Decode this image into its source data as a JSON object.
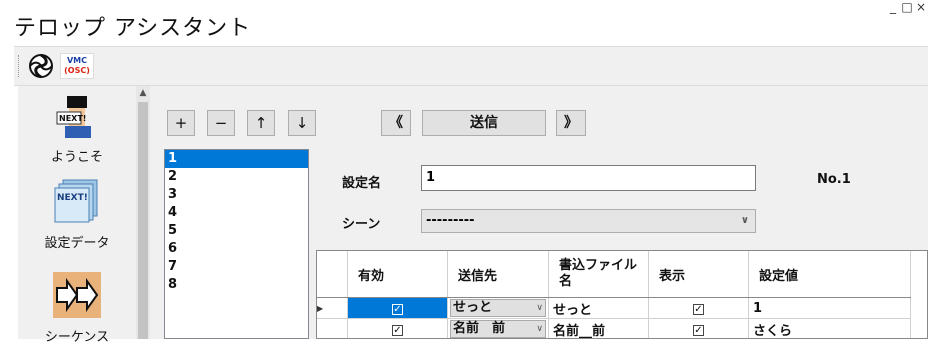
{
  "window": {
    "title": "テロップ アシスタント",
    "controls": [
      "_",
      "□",
      "×"
    ]
  },
  "toolbar": {
    "vmc_text": "VMC",
    "osc_text": "(OSC)"
  },
  "sidebar": {
    "items": [
      {
        "label": "ようこそ",
        "icon": "welcome-person-icon"
      },
      {
        "label": "設定データ",
        "icon": "settings-data-icon"
      },
      {
        "label": "シーケンス",
        "icon": "sequence-arrows-icon"
      }
    ],
    "icon_text": "NEXT!"
  },
  "controls": {
    "add": "+",
    "remove": "−",
    "up": "↑",
    "down": "↓",
    "prev": "《",
    "send": "送信",
    "next": "》"
  },
  "list": {
    "items": [
      "1",
      "2",
      "3",
      "4",
      "5",
      "6",
      "7",
      "8"
    ],
    "selected": "1"
  },
  "form": {
    "name_label": "設定名",
    "name_value": "1",
    "number_label": "No.1",
    "scene_label": "シーン",
    "scene_value": "---------"
  },
  "grid": {
    "headers": [
      "有効",
      "送信先",
      "書込ファイル名",
      "表示",
      "設定値"
    ],
    "rows": [
      {
        "enabled": true,
        "destination": "せっと",
        "file": "せっと",
        "display": true,
        "value": "1"
      },
      {
        "enabled": true,
        "destination": "名前　前",
        "file": "名前__前",
        "display": true,
        "value": "さくら"
      }
    ]
  },
  "colors": {
    "selection": "#0078d7",
    "panel": "#f0f0f0",
    "button": "#e1e1e1"
  }
}
